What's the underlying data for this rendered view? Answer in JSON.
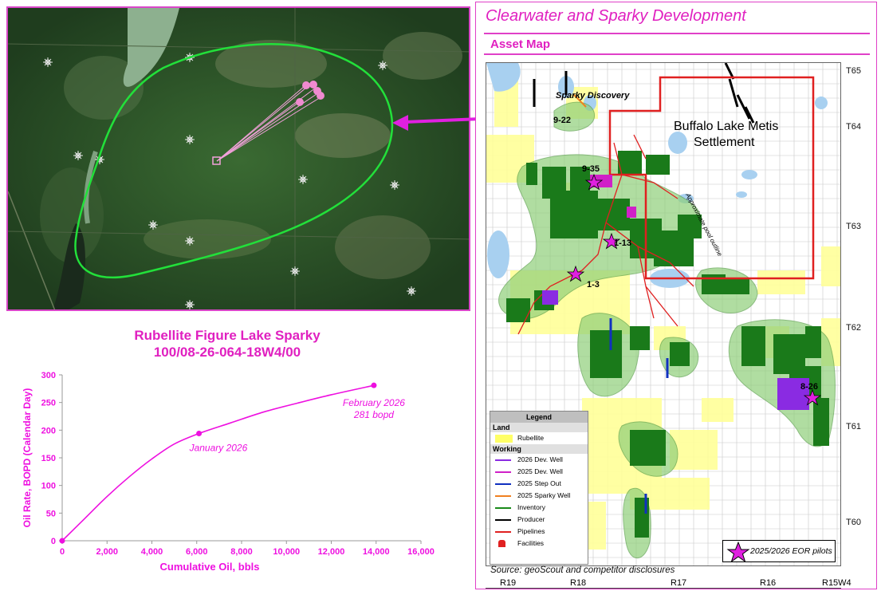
{
  "satellite": {
    "colors": {
      "forest": "#2e5a2a",
      "outline": "#22e03a",
      "wells": "#f08ad0",
      "water": "#7fa88a"
    }
  },
  "chart": {
    "title_line1": "Rubellite Figure Lake Sparky",
    "title_line2": "100/08-26-064-18W4/00",
    "annotations": [
      {
        "text": "January 2026"
      },
      {
        "text": "February 2026"
      },
      {
        "text": "281 bopd"
      }
    ]
  },
  "chart_data": {
    "type": "line",
    "title": "Rubellite Figure Lake Sparky 100/08-26-064-18W4/00",
    "xlabel": "Cumulative Oil, bbls",
    "ylabel": "Oil Rate, BOPD (Calendar Day)",
    "xlim": [
      0,
      16000
    ],
    "ylim": [
      0,
      300
    ],
    "x_ticks": [
      "0",
      "2,000",
      "4,000",
      "6,000",
      "8,000",
      "10,000",
      "12,000",
      "14,000",
      "16,000"
    ],
    "y_ticks": [
      "0",
      "50",
      "100",
      "150",
      "200",
      "250",
      "300"
    ],
    "grid": false,
    "color": "#ee10e0",
    "points": [
      {
        "x": 0,
        "y": 0,
        "marker": true
      },
      {
        "x": 6100,
        "y": 194,
        "marker": true,
        "label": "January 2026"
      },
      {
        "x": 13900,
        "y": 281,
        "marker": true,
        "label": "February 2026 281 bopd"
      }
    ],
    "curve": [
      {
        "x": 0,
        "y": 0
      },
      {
        "x": 1000,
        "y": 40
      },
      {
        "x": 2000,
        "y": 80
      },
      {
        "x": 3000,
        "y": 116
      },
      {
        "x": 4000,
        "y": 148
      },
      {
        "x": 5000,
        "y": 175
      },
      {
        "x": 6100,
        "y": 194
      },
      {
        "x": 7500,
        "y": 213
      },
      {
        "x": 9000,
        "y": 233
      },
      {
        "x": 10500,
        "y": 249
      },
      {
        "x": 12000,
        "y": 264
      },
      {
        "x": 13900,
        "y": 281
      }
    ]
  },
  "panel": {
    "title": "Clearwater and Sparky Development",
    "subtitle": "Asset Map",
    "source": "Source: geoScout and competitor disclosures"
  },
  "map": {
    "labels": {
      "settlement": "Buffalo Lake Metis Settlement",
      "settlement_line1": "Buffalo Lake Metis",
      "settlement_line2": "Settlement",
      "pool_outline": "Approximate pool outline",
      "sparky_discovery": "Sparky Discovery",
      "wells": [
        "9-22",
        "9-35",
        "1-13",
        "1-3",
        "8-26"
      ]
    },
    "townships": [
      "T65",
      "T64",
      "T63",
      "T62",
      "T61",
      "T60"
    ],
    "ranges": [
      "R19",
      "R18",
      "R17",
      "R16",
      "R15W4"
    ],
    "eor_label": "2025/2026 EOR pilots",
    "colors": {
      "land": "#ffff99",
      "inventory": "#1a7a1a",
      "pool": "#8fcf7a",
      "settlement": "#e02020",
      "pipelines": "#e02020",
      "eor_star": "#e020e0",
      "dev2026": "#8a2be2",
      "dev2025": "#e020c0",
      "water": "#a8d0f0"
    }
  },
  "legend": {
    "title": "Legend",
    "land_header": "Land",
    "land_items": [
      {
        "label": "Rubellite",
        "color": "#ffff66"
      }
    ],
    "working_header": "Working",
    "working_items": [
      {
        "label": "2026 Dev. Well",
        "color": "#8a2be2"
      },
      {
        "label": "2025 Dev. Well",
        "color": "#d020c8"
      },
      {
        "label": "2025 Step Out",
        "color": "#1030c0"
      },
      {
        "label": "2025 Sparky Well",
        "color": "#f08020"
      },
      {
        "label": "Inventory",
        "color": "#1a8a1a"
      },
      {
        "label": "Producer",
        "color": "#000000"
      },
      {
        "label": "Pipelines",
        "color": "#e02020"
      },
      {
        "label": "Facilities",
        "color": "#e02020",
        "icon": "facility-icon"
      }
    ]
  }
}
